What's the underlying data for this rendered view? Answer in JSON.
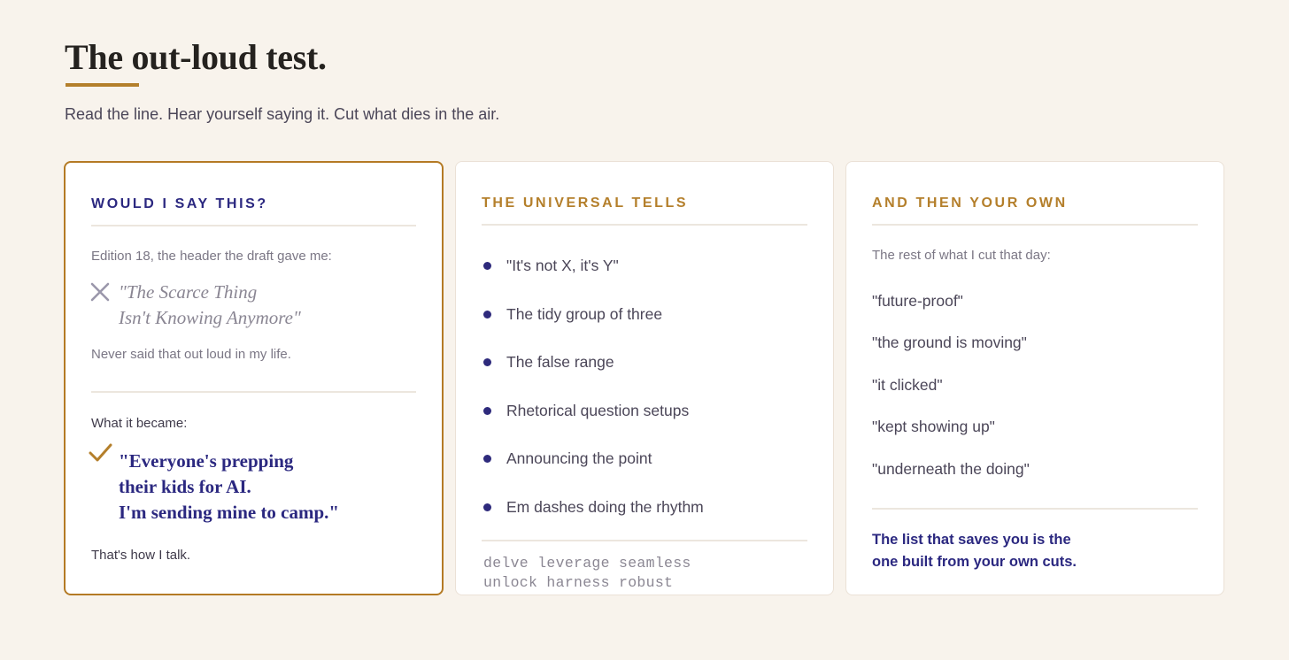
{
  "header": {
    "title": "The out-loud test.",
    "subtitle": "Read the line. Hear yourself saying it. Cut what dies in the air."
  },
  "colors": {
    "accent_gold": "#b47f2b",
    "navy": "#2b2880",
    "background": "#f8f3ec"
  },
  "card_say": {
    "heading": "WOULD I SAY THIS?",
    "before_label": "Edition 18, the header the draft gave me:",
    "rejected_icon": "x-icon",
    "rejected_line_1": "\"The Scarce Thing",
    "rejected_line_2": "Isn't Knowing Anymore\"",
    "rejected_note": "Never said that out loud in my life.",
    "after_label": "What it became:",
    "accepted_icon": "checkmark-icon",
    "accepted_line_1": "\"Everyone's prepping",
    "accepted_line_2": "their kids for AI.",
    "accepted_line_3": "I'm sending mine to camp.\"",
    "accepted_note": "That's how I talk."
  },
  "card_tells": {
    "heading": "THE UNIVERSAL TELLS",
    "items": [
      "\"It's not X, it's Y\"",
      "The tidy group of three",
      "The false range",
      "Rhetorical question setups",
      "Announcing the point",
      "Em dashes doing the rhythm"
    ],
    "words_line_1": "delve leverage seamless",
    "words_line_2": "unlock harness robust"
  },
  "card_own": {
    "heading": "AND THEN YOUR OWN",
    "intro": "The rest of what I cut that day:",
    "cuts": [
      "\"future-proof\"",
      "\"the ground is moving\"",
      "\"it clicked\"",
      "\"kept showing up\"",
      "\"underneath the doing\""
    ],
    "closing_line_1": "The list that saves you is the",
    "closing_line_2": "one built from your own cuts."
  }
}
